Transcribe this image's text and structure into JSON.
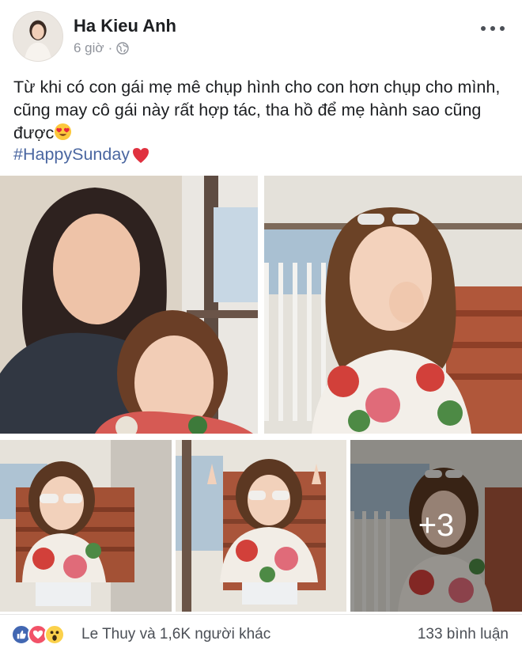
{
  "post": {
    "author": "Ha Kieu Anh",
    "time": "6 giờ",
    "separator": "·",
    "privacy_icon": "globe-icon",
    "text": "Từ khi có con gái mẹ mê chụp hình cho con hơn chụp cho mình, cũng may cô gái này rất hợp tác, tha hồ để mẹ hành sao cũng được",
    "text_emoji": "heart-eyes-emoji",
    "hashtag": "#HappySunday",
    "hashtag_emoji": "red-heart-emoji"
  },
  "photos": {
    "more_count": "+3"
  },
  "footer": {
    "reaction_icons": [
      "like-icon",
      "love-icon",
      "wow-icon"
    ],
    "reactions_text": "Le Thuy và 1,6K người khác",
    "comments_text": "133 bình luận"
  },
  "colors": {
    "link": "#4b67a1",
    "like": "#4267b2",
    "love": "#f25268",
    "wow": "#fbd14b"
  }
}
